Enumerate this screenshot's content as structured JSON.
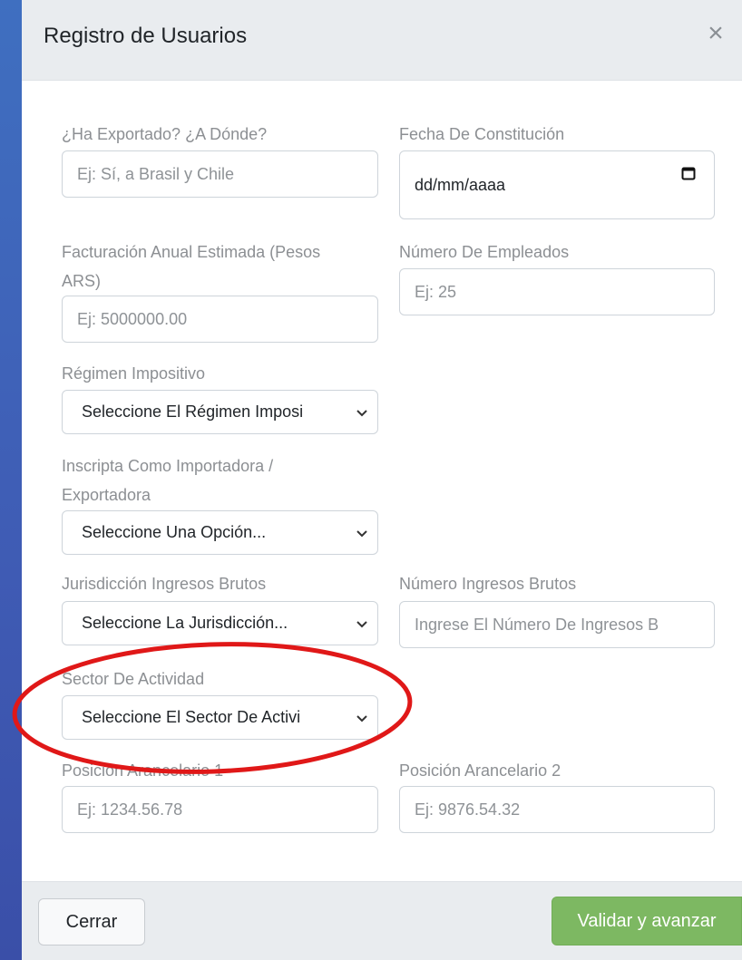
{
  "header": {
    "title": "Registro de Usuarios",
    "close_icon": "×"
  },
  "fields": {
    "exported": {
      "label": "¿Ha Exportado? ¿A Dónde?",
      "placeholder": "Ej: Sí, a Brasil y Chile"
    },
    "constitution_date": {
      "label": "Fecha De Constitución",
      "value": "dd/mm/aaaa"
    },
    "annual_revenue": {
      "label_line1": "Facturación Anual Estimada (Pesos",
      "label_line2": "ARS)",
      "placeholder": "Ej: 5000000.00"
    },
    "employees": {
      "label": "Número De Empleados",
      "placeholder": "Ej: 25"
    },
    "tax_regime": {
      "label": "Régimen Impositivo",
      "selected": "Seleccione El Régimen Imposi"
    },
    "importer_exporter": {
      "label_line1": "Inscripta Como Importadora /",
      "label_line2": "Exportadora",
      "selected": "Seleccione Una Opción..."
    },
    "jurisdiction": {
      "label": "Jurisdicción Ingresos Brutos",
      "selected": "Seleccione La Jurisdicción..."
    },
    "gross_income_number": {
      "label": "Número Ingresos Brutos",
      "placeholder": "Ingrese El Número De Ingresos B"
    },
    "activity_sector": {
      "label": "Sector De Actividad",
      "selected": "Seleccione El Sector De Activi"
    },
    "tariff_1": {
      "label": "Posición Arancelario 1",
      "placeholder": "Ej: 1234.56.78"
    },
    "tariff_2": {
      "label": "Posición Arancelario 2",
      "placeholder": "Ej: 9876.54.32"
    }
  },
  "footer": {
    "close_label": "Cerrar",
    "submit_label": "Validar y avanzar"
  },
  "colors": {
    "header_bg": "#e9ecef",
    "primary_button": "#7db862",
    "highlight_ring": "#e01818",
    "background": "#3f5bb4"
  }
}
